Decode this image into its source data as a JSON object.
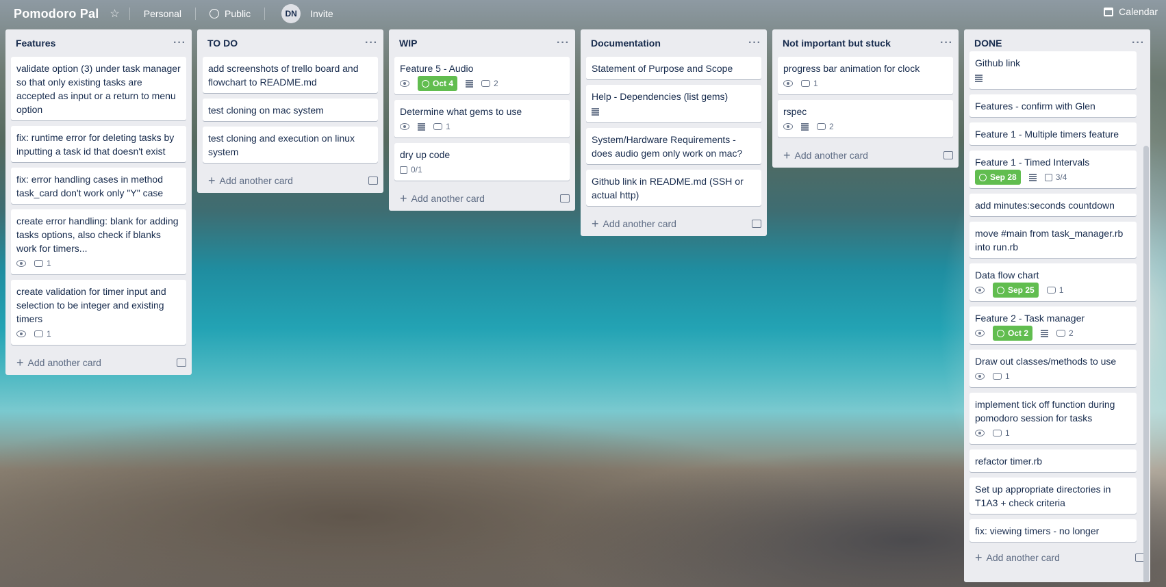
{
  "header": {
    "board_title": "Pomodoro Pal",
    "team": "Personal",
    "visibility": "Public",
    "avatar_initials": "DN",
    "invite": "Invite",
    "calendar": "Calendar"
  },
  "add_card_label": "Add another card",
  "lists": [
    {
      "title": "Features",
      "cards": [
        {
          "title": "validate option (3) under task manager so that only existing tasks are accepted as input or a return to menu option"
        },
        {
          "title": "fix: runtime error for deleting tasks by inputting a task id that doesn't exist"
        },
        {
          "title": "fix: error handling cases in method task_card don't work only \"Y\" case"
        },
        {
          "title": "create error handling: blank for adding tasks options, also check if blanks work for timers...",
          "comments": "1"
        },
        {
          "title": "create validation for timer input and selection to be integer and existing timers",
          "comments": "1"
        }
      ]
    },
    {
      "title": "TO DO",
      "cards": [
        {
          "title": "add screenshots of trello board and flowchart to README.md"
        },
        {
          "title": "test cloning on mac system"
        },
        {
          "title": "test cloning and execution on linux system"
        }
      ]
    },
    {
      "title": "WIP",
      "cards": [
        {
          "title": "Feature 5 - Audio",
          "due": "Oct 4",
          "desc": true,
          "comments": "2"
        },
        {
          "title": "Determine what gems to use",
          "desc": true,
          "comments": "1"
        },
        {
          "title": "dry up code",
          "checklist": "0/1"
        }
      ]
    },
    {
      "title": "Documentation",
      "cards": [
        {
          "title": "Statement of Purpose and Scope"
        },
        {
          "title": "Help - Dependencies (list gems)",
          "desc_only": true
        },
        {
          "title": "System/Hardware Requirements - does audio gem only work on mac?"
        },
        {
          "title": "Github link in README.md (SSH or actual http)"
        }
      ]
    },
    {
      "title": "Not important but stuck",
      "cards": [
        {
          "title": "progress bar animation for clock",
          "comments": "1"
        },
        {
          "title": "rspec",
          "desc": true,
          "comments": "2"
        }
      ]
    },
    {
      "title": "DONE",
      "cards": [
        {
          "title": "Github link",
          "desc_only": true
        },
        {
          "title": "Features - confirm with Glen"
        },
        {
          "title": "Feature 1 - Multiple timers feature"
        },
        {
          "title": "Feature 1 - Timed Intervals",
          "due": "Sep 28",
          "desc": true,
          "checklist": "3/4",
          "no_eye": true
        },
        {
          "title": "add minutes:seconds countdown"
        },
        {
          "title": "move #main from task_manager.rb into run.rb"
        },
        {
          "title": "Data flow chart",
          "due": "Sep 25",
          "comments": "1"
        },
        {
          "title": "Feature 2 - Task manager",
          "due": "Oct 2",
          "desc": true,
          "comments": "2"
        },
        {
          "title": "Draw out classes/methods to use",
          "comments": "1"
        },
        {
          "title": "implement tick off function during pomodoro session for tasks",
          "comments": "1"
        },
        {
          "title": "refactor timer.rb"
        },
        {
          "title": "Set up appropriate directories in T1A3 + check criteria"
        },
        {
          "title": "fix: viewing timers - no longer"
        }
      ]
    }
  ]
}
